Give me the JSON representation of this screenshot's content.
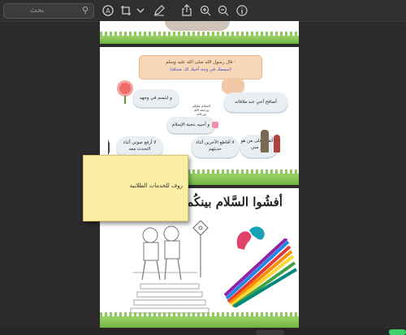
{
  "toolbar": {
    "search_placeholder": "بحث",
    "icons": [
      "search-icon",
      "markup-icon",
      "crop-icon",
      "chevron-down-icon",
      "pen-icon",
      "share-icon",
      "zoom-in-icon",
      "zoom-out-icon",
      "info-icon"
    ]
  },
  "page2": {
    "hadith_line1": "قال رسول الله صلى الله عليه وسلم :",
    "hadith_line2": "(تبسمك في وجه أخيك لك صدقة)",
    "cloud_smile": "و ابتسم في وجهه",
    "cloud_shake": "أصافح أخي عند ملاقاته",
    "cloud_greeting": "و أحييه بتحية الإسلام",
    "cloud_salam_small": "السلام عليكم ورحمة الله وبركاته",
    "cloud_voice": "لا أرفع صوتي أثناء التحدث معه",
    "cloud_interrupt": "لا أقاطع الآخرين أثناء حديثهم",
    "cloud_elder": "لا أتقدم على من هو أكبر مني"
  },
  "page3": {
    "title": "أفشُوا السَّلام بينكُم"
  },
  "sticky_note": {
    "text": "روف للخدمات الطلابية"
  },
  "colors": {
    "background": "#2b2b2b",
    "sticky": "#fbeea5",
    "hadith_bg": "#f8d6b8",
    "accent_green": "#3fd16a"
  }
}
